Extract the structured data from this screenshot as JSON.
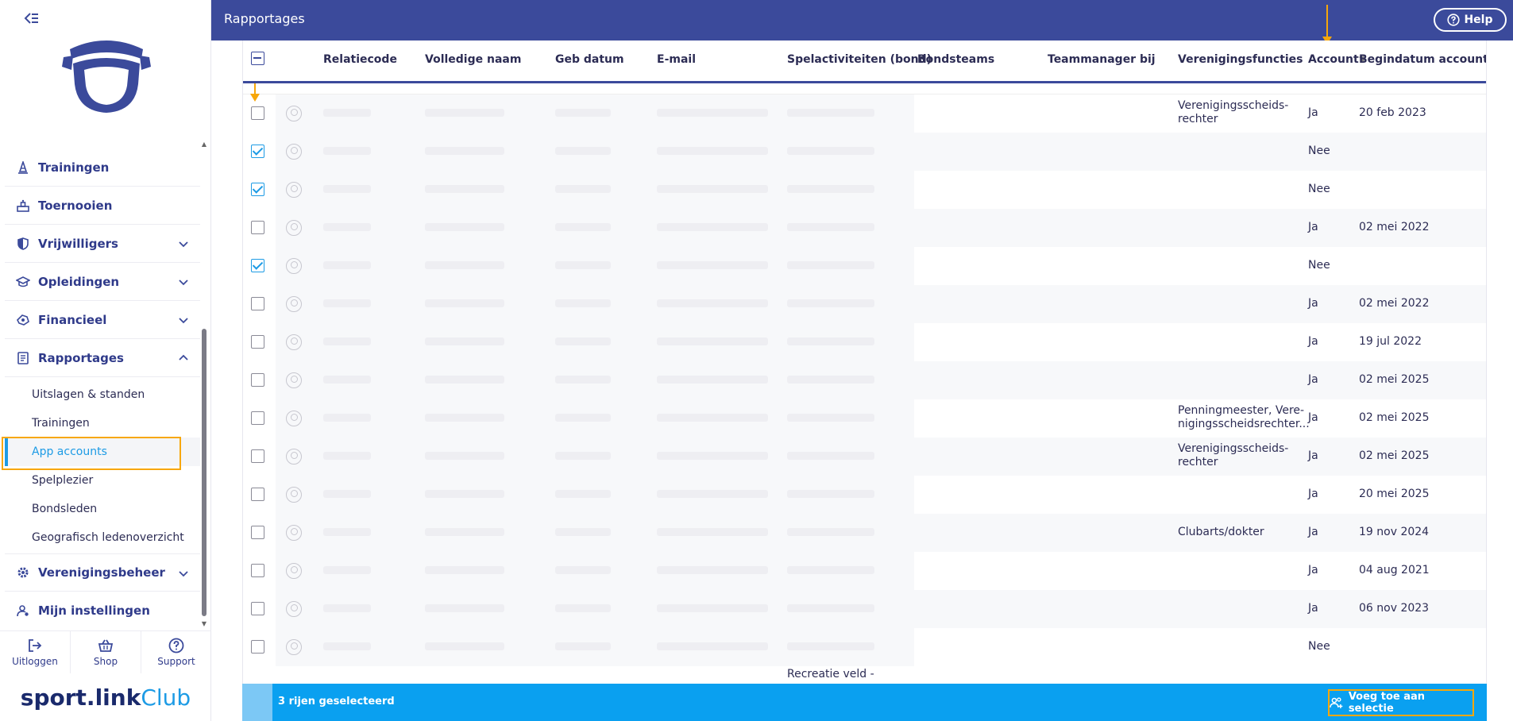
{
  "header": {
    "title": "Rapportages",
    "help_label": "Help"
  },
  "sidebar": {
    "items": [
      {
        "label": "Trainingen",
        "icon": "cone-icon",
        "expandable": false
      },
      {
        "label": "Toernooien",
        "icon": "podium-icon",
        "expandable": false
      },
      {
        "label": "Vrijwilligers",
        "icon": "heart-shield-icon",
        "expandable": true
      },
      {
        "label": "Opleidingen",
        "icon": "graduation-cap-icon",
        "expandable": true
      },
      {
        "label": "Financieel",
        "icon": "money-icon",
        "expandable": true
      },
      {
        "label": "Rapportages",
        "icon": "report-icon",
        "expandable": true,
        "expanded": true
      },
      {
        "label": "Verenigingsbeheer",
        "icon": "gear-icon",
        "expandable": true
      },
      {
        "label": "Mijn instellingen",
        "icon": "user-settings-icon",
        "expandable": false
      }
    ],
    "sub_items": [
      "Uitslagen & standen",
      "Trainingen",
      "App accounts",
      "Spelplezier",
      "Bondsleden",
      "Geografisch ledenoverzicht"
    ],
    "active_sub": "App accounts",
    "bottom": {
      "logout": "Uitloggen",
      "shop": "Shop",
      "support": "Support"
    },
    "brand": {
      "part1": "sport.link",
      "part2": " Club"
    }
  },
  "table": {
    "columns": [
      "Relatiecode",
      "Volledige naam",
      "Geb datum",
      "E-mail",
      "Spelactiviteiten (bond)",
      "Bondsteams",
      "Teammanager bij",
      "Verenigingsfuncties",
      "Account",
      "Begindatum account"
    ],
    "rows": [
      {
        "checked": false,
        "functies": "Verenigingsscheids-\nrechter",
        "account": "Ja",
        "begindatum": "20 feb 2023"
      },
      {
        "checked": true,
        "functies": "",
        "account": "Nee",
        "begindatum": ""
      },
      {
        "checked": true,
        "functies": "",
        "account": "Nee",
        "begindatum": ""
      },
      {
        "checked": false,
        "functies": "",
        "account": "Ja",
        "begindatum": "02 mei 2022"
      },
      {
        "checked": true,
        "functies": "",
        "account": "Nee",
        "begindatum": ""
      },
      {
        "checked": false,
        "functies": "",
        "account": "Ja",
        "begindatum": "02 mei 2022"
      },
      {
        "checked": false,
        "functies": "",
        "account": "Ja",
        "begindatum": "19 jul 2022"
      },
      {
        "checked": false,
        "functies": "",
        "account": "Ja",
        "begindatum": "02 mei 2025"
      },
      {
        "checked": false,
        "functies": "Penningmeester, Vere-\nnigingsscheidsrechter...",
        "account": "Ja",
        "begindatum": "02 mei 2025"
      },
      {
        "checked": false,
        "functies": "Verenigingsscheids-\nrechter",
        "account": "Ja",
        "begindatum": "02 mei 2025"
      },
      {
        "checked": false,
        "functies": "",
        "account": "Ja",
        "begindatum": "20 mei 2025"
      },
      {
        "checked": false,
        "functies": "Clubarts/dokter",
        "account": "Ja",
        "begindatum": "19 nov 2024"
      },
      {
        "checked": false,
        "functies": "",
        "account": "Ja",
        "begindatum": "04 aug 2021"
      },
      {
        "checked": false,
        "functies": "",
        "account": "Ja",
        "begindatum": "06 nov 2023"
      },
      {
        "checked": false,
        "functies": "",
        "account": "Nee",
        "begindatum": ""
      }
    ],
    "partial_bottom_text": "Recreatie veld -"
  },
  "selection_bar": {
    "count_text": "3 rijen geselecteerd",
    "add_label": "Voeg toe aan selectie"
  },
  "colors": {
    "primary": "#3b4a9b",
    "accent": "#1d9be5",
    "highlight": "#f7a70a",
    "selection_bar": "#0aa0f0"
  }
}
